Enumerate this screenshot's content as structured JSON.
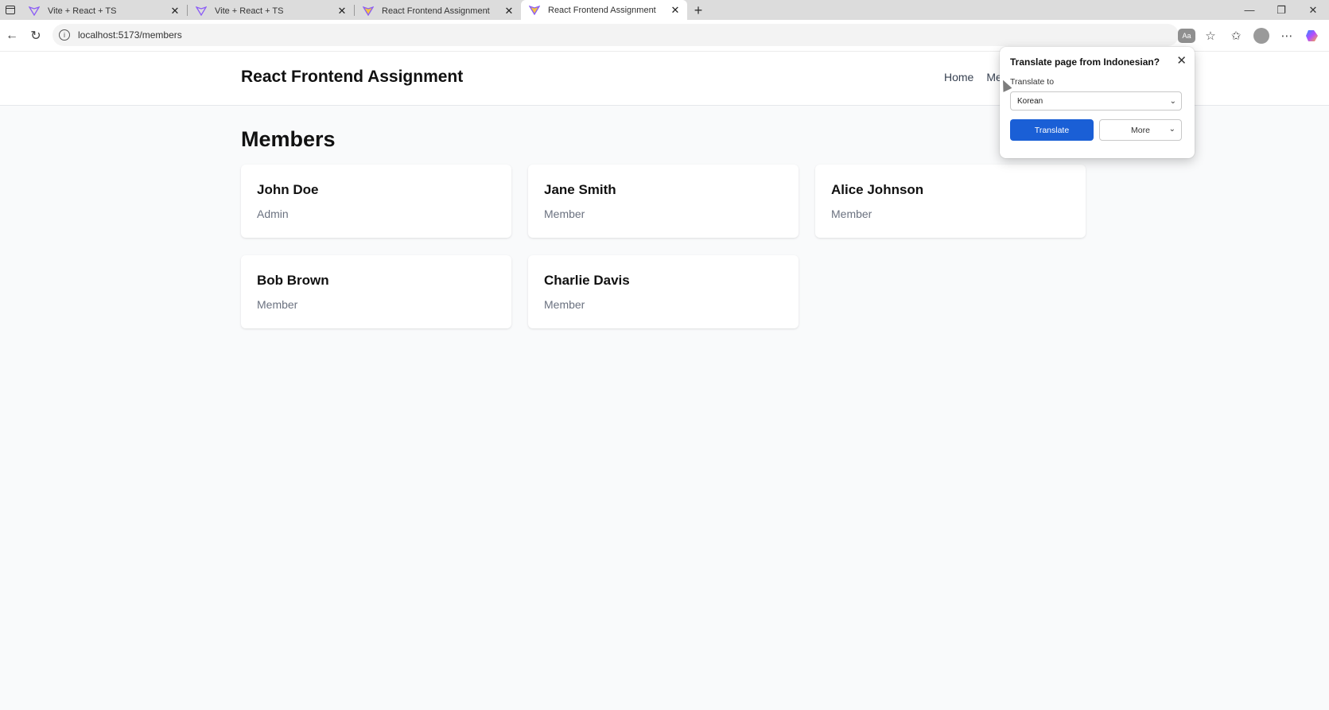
{
  "browser": {
    "tabs": [
      {
        "title": "Vite + React + TS",
        "close": "✕",
        "active": false
      },
      {
        "title": "Vite + React + TS",
        "close": "✕",
        "active": false
      },
      {
        "title": "React Frontend Assignment",
        "close": "✕",
        "active": false
      },
      {
        "title": "React Frontend Assignment",
        "close": "✕",
        "active": true
      }
    ],
    "new_tab": "+",
    "url": "localhost:5173/members",
    "window_controls": {
      "minimize": "—",
      "restore": "❐",
      "close": "✕"
    }
  },
  "app": {
    "brand": "React Frontend Assignment",
    "nav": [
      {
        "label": "Home"
      },
      {
        "label": "Me"
      }
    ]
  },
  "page": {
    "title": "Members",
    "members": [
      {
        "name": "John Doe",
        "role": "Admin"
      },
      {
        "name": "Jane Smith",
        "role": "Member"
      },
      {
        "name": "Alice Johnson",
        "role": "Member"
      },
      {
        "name": "Bob Brown",
        "role": "Member"
      },
      {
        "name": "Charlie Davis",
        "role": "Member"
      }
    ]
  },
  "translate_popup": {
    "title": "Translate page from Indonesian?",
    "label": "Translate to",
    "selected_language": "Korean",
    "translate_button": "Translate",
    "more_button": "More"
  },
  "colors": {
    "primary_button": "#1a5fd6",
    "page_background": "#f9fafb"
  }
}
